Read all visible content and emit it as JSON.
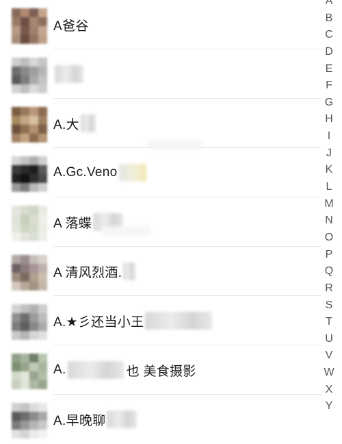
{
  "contacts": [
    {
      "name": "A爸谷",
      "avatar": [
        "#8a6a5a",
        "#b08a70",
        "#7d5e55",
        "#c7a58c",
        "#9a7a66",
        "#6f4f45",
        "#a48872",
        "#8e6f5e",
        "#b59a86",
        "#7a5a4c",
        "#9e8070",
        "#c2a792",
        "#a88d7b",
        "#6b4d42",
        "#947462",
        "#bda08a"
      ]
    },
    {
      "name": "",
      "avatar": [
        "#cfcfcf",
        "#bdbdbd",
        "#d8d8d8",
        "#c6c6c6",
        "#6f6f6f",
        "#8a8a8a",
        "#9f9f9f",
        "#b5b5b5",
        "#5c5c5c",
        "#7d7d7d",
        "#a9a9a9",
        "#c3c3c3",
        "#d2d2d2",
        "#bfbfbf",
        "#dadada",
        "#cccccc"
      ]
    },
    {
      "name": "A.大",
      "avatar": [
        "#7a5e44",
        "#9a7a5a",
        "#b8987a",
        "#8c6b4e",
        "#a8885f",
        "#c5a785",
        "#d6c0a0",
        "#9f7f60",
        "#6e533c",
        "#8f7050",
        "#b1916f",
        "#7d6047",
        "#a38363",
        "#c2a27f",
        "#8b6c4f",
        "#b39473"
      ]
    },
    {
      "name": "A.Gc.Veno",
      "avatar": [
        "#d6d6d6",
        "#c2c2c2",
        "#b0b0b0",
        "#cfcfcf",
        "#3a3a3a",
        "#2b2b2b",
        "#1f1f1f",
        "#5a5a5a",
        "#222222",
        "#111111",
        "#2e2e2e",
        "#4a4a4a",
        "#9a9a9a",
        "#7c7c7c",
        "#b8b8b8",
        "#d0d0d0"
      ]
    },
    {
      "name": "A 落蝶",
      "avatar": [
        "#e6e6e0",
        "#d8dccf",
        "#cfd6c6",
        "#e9ebe3",
        "#dfe3d6",
        "#c6d0ba",
        "#d9ded0",
        "#eeefe9",
        "#e1e5da",
        "#cdd5c1",
        "#d6dccb",
        "#ebede5",
        "#f0f1ec",
        "#e3e6dc",
        "#dadfd1",
        "#eceee7"
      ]
    },
    {
      "name": "A  清风烈酒.",
      "avatar": [
        "#b4a9a6",
        "#9c8f8f",
        "#c7bdb8",
        "#d8d0cb",
        "#6f6063",
        "#8b7c7e",
        "#a69597",
        "#bfb1ae",
        "#9d8e7e",
        "#7a6b60",
        "#b09f8e",
        "#cbbdac",
        "#d2c8bd",
        "#b8a99a",
        "#a29384",
        "#c4b7a8"
      ]
    },
    {
      "name": "A.★彡还当小王",
      "avatar": [
        "#d3d3d3",
        "#c0c0c0",
        "#b2b2b2",
        "#cdcdcd",
        "#8f8f8f",
        "#6e6e6e",
        "#9b9b9b",
        "#bdbdbd",
        "#7b7b7b",
        "#5f5f5f",
        "#888888",
        "#aaaaaa",
        "#c9c9c9",
        "#b6b6b6",
        "#d6d6d6",
        "#e0e0e0"
      ]
    },
    {
      "name": "A.",
      "name2": "也 美食摄影",
      "avatar": [
        "#8fa08a",
        "#a4b39c",
        "#6f8068",
        "#b9c6b0",
        "#7d8e73",
        "#96a58b",
        "#c0c9b5",
        "#a8b59e",
        "#d2d9c8",
        "#e2e6db",
        "#9aa58f",
        "#b3bea8",
        "#c8cfbe",
        "#dfe3d7",
        "#aeb8a3",
        "#98a58d"
      ]
    },
    {
      "name": "A.早晚聊",
      "avatar": [
        "#d0d0d0",
        "#c4c4c4",
        "#dcdcdc",
        "#e6e6e6",
        "#5b5b5b",
        "#6e6e6e",
        "#8c8c8c",
        "#a8a8a8",
        "#7a7a7a",
        "#999999",
        "#b5b5b5",
        "#cacaca",
        "#e0e0e0",
        "#d5d5d5",
        "#ebebeb",
        "#f1f1f1"
      ]
    }
  ],
  "index_letters": [
    "A",
    "B",
    "C",
    "D",
    "E",
    "F",
    "G",
    "H",
    "I",
    "J",
    "K",
    "L",
    "M",
    "N",
    "O",
    "P",
    "Q",
    "R",
    "S",
    "T",
    "U",
    "V",
    "W",
    "X",
    "Y"
  ]
}
